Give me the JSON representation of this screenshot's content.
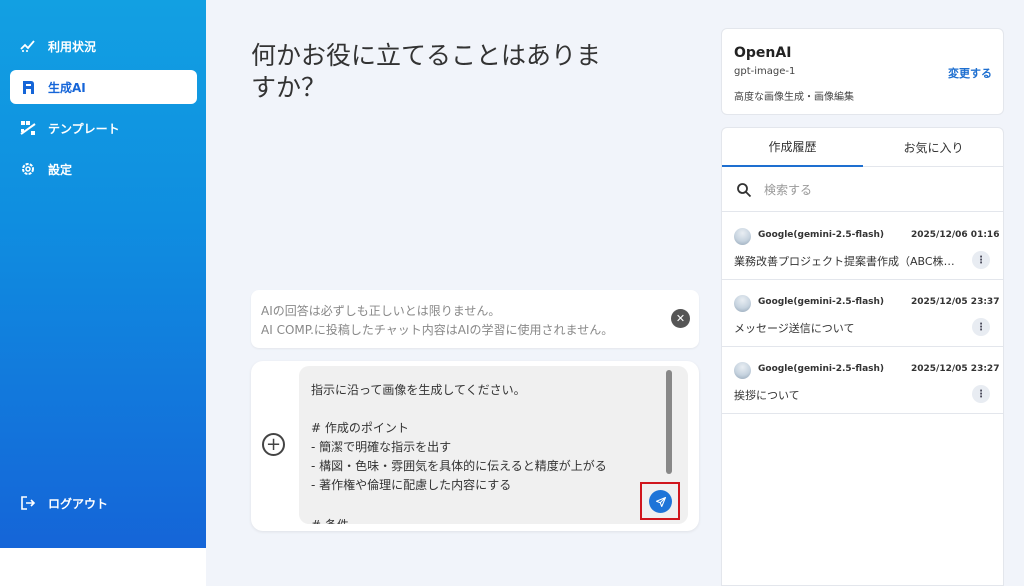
{
  "sidebar": {
    "items": [
      {
        "label": "利用状況",
        "icon": "usage-chart-icon"
      },
      {
        "label": "生成AI",
        "icon": "ai-generate-icon",
        "active": true
      },
      {
        "label": "テンプレート",
        "icon": "template-grid-icon"
      },
      {
        "label": "設定",
        "icon": "gear-icon"
      }
    ],
    "logout_label": "ログアウト",
    "logout_icon": "logout-icon"
  },
  "main": {
    "title_line1": "何かお役に立てることはありま",
    "title_line2": "すか？",
    "notice": {
      "line1": "AIの回答は必ずしも正しいとは限りません。",
      "line2": "AI COMP.に投稿したチャット内容はAIの学習に使用されません。"
    },
    "composer": {
      "lines": [
        "指示に沿って画像を生成してください。",
        "",
        "# 作成のポイント",
        "- 簡潔で明確な指示を出す",
        "- 構図・色味・雰囲気を具体的に伝えると精度が上がる",
        "- 著作権や倫理に配慮した内容にする",
        "",
        "# 条件"
      ]
    }
  },
  "model": {
    "name": "OpenAI",
    "id": "gpt-image-1",
    "description": "高度な画像生成・画像編集",
    "change_label": "変更する"
  },
  "history": {
    "tabs": [
      "作成履歴",
      "お気に入り"
    ],
    "search_placeholder": "検索する",
    "items": [
      {
        "model": "Google(gemini-2.5-flash)",
        "date": "2025/12/06 01:16",
        "title": "業務改善プロジェクト提案書作成（ABC株式会社）"
      },
      {
        "model": "Google(gemini-2.5-flash)",
        "date": "2025/12/05 23:37",
        "title": "メッセージ送信について"
      },
      {
        "model": "Google(gemini-2.5-flash)",
        "date": "2025/12/05 23:27",
        "title": "挨拶について"
      }
    ]
  },
  "colors": {
    "accent": "#1e6fd0",
    "sidebar_top": "#12a0e2",
    "sidebar_bottom": "#1565d8",
    "highlight": "#d0161d"
  }
}
